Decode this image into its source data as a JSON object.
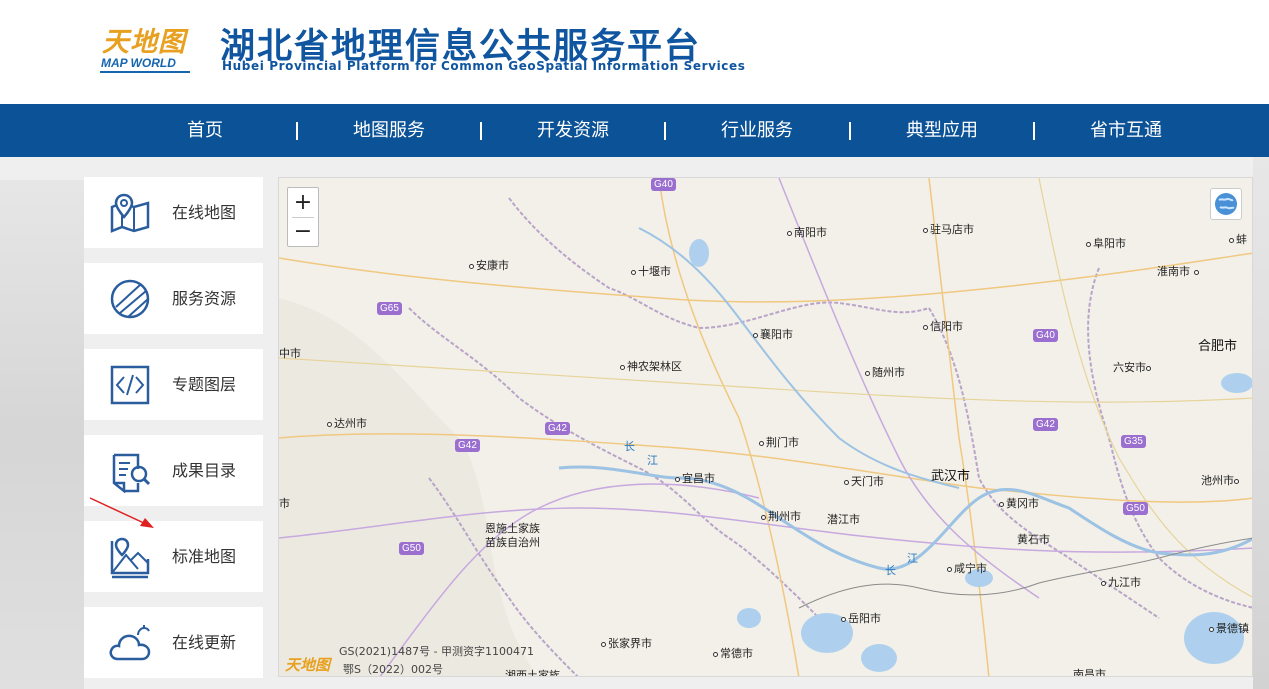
{
  "header": {
    "logo_cn": "天地图",
    "logo_en": "MAP WORLD",
    "title": "湖北省地理信息公共服务平台",
    "subtitle": "Hubei Provincial Platform for Common GeoSpatial Information Services"
  },
  "nav": {
    "items": [
      {
        "label": "首页"
      },
      {
        "label": "地图服务"
      },
      {
        "label": "开发资源"
      },
      {
        "label": "行业服务"
      },
      {
        "label": "典型应用"
      },
      {
        "label": "省市互通"
      }
    ]
  },
  "sidebar": {
    "items": [
      {
        "label": "在线地图",
        "icon": "map-pin-icon"
      },
      {
        "label": "服务资源",
        "icon": "globe-slash-icon"
      },
      {
        "label": "专题图层",
        "icon": "code-icon"
      },
      {
        "label": "成果目录",
        "icon": "document-search-icon"
      },
      {
        "label": "标准地图",
        "icon": "standard-map-icon"
      },
      {
        "label": "在线更新",
        "icon": "cloud-update-icon"
      }
    ]
  },
  "map": {
    "zoom_in": "+",
    "zoom_out": "−",
    "cities": [
      {
        "name": "南阳市"
      },
      {
        "name": "驻马店市"
      },
      {
        "name": "阜阳市"
      },
      {
        "name": "蚌"
      },
      {
        "name": "安康市"
      },
      {
        "name": "十堰市"
      },
      {
        "name": "淮南市"
      },
      {
        "name": "信阳市"
      },
      {
        "name": "襄阳市"
      },
      {
        "name": "中市"
      },
      {
        "name": "合肥市"
      },
      {
        "name": "神农架林区"
      },
      {
        "name": "随州市"
      },
      {
        "name": "六安市"
      },
      {
        "name": "达州市"
      },
      {
        "name": "荆门市"
      },
      {
        "name": "宜昌市"
      },
      {
        "name": "天门市"
      },
      {
        "name": "武汉市"
      },
      {
        "name": "池州市"
      },
      {
        "name": "市"
      },
      {
        "name": "恩施土家族"
      },
      {
        "name": "苗族自治州"
      },
      {
        "name": "荆州市"
      },
      {
        "name": "潜江市"
      },
      {
        "name": "黄冈市"
      },
      {
        "name": "黄石市"
      },
      {
        "name": "咸宁市"
      },
      {
        "name": "九江市"
      },
      {
        "name": "张家界市"
      },
      {
        "name": "常德市"
      },
      {
        "name": "岳阳市"
      },
      {
        "name": "景德镇"
      },
      {
        "name": "湘西土家族"
      },
      {
        "name": "南昌市"
      }
    ],
    "highways": [
      "G40",
      "G65",
      "G40",
      "G42",
      "G42",
      "G42",
      "G35",
      "G50",
      "G50"
    ],
    "rivers": [
      "长",
      "江",
      "长",
      "江"
    ],
    "footer_line1": "GS(2021)1487号 - 甲测资字1100471",
    "footer_line2": "鄂S（2022）002号",
    "footer_logo": "天地图"
  },
  "colors": {
    "nav_bg": "#0b5296",
    "title_blue": "#0f55a0",
    "logo_orange": "#e8a020"
  }
}
